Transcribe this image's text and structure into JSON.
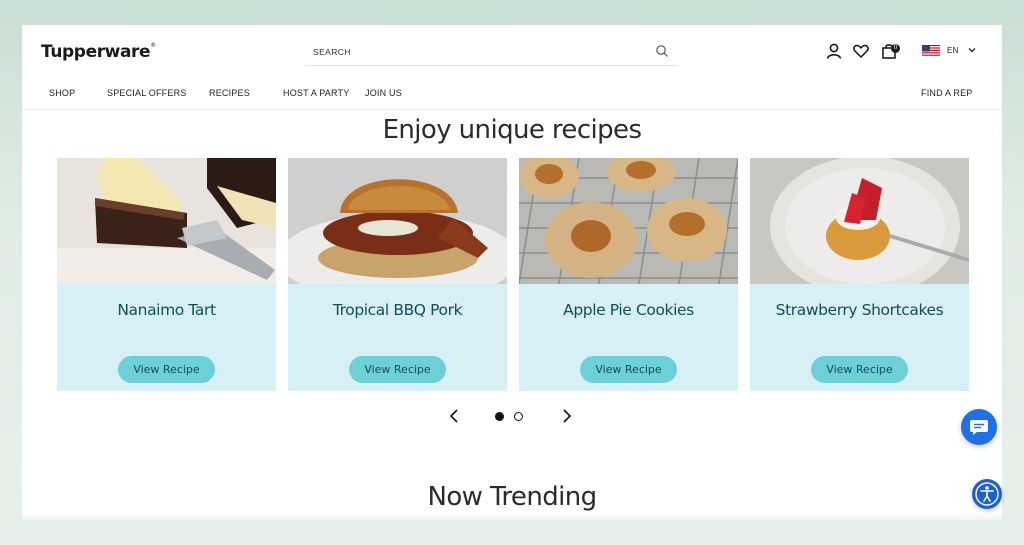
{
  "header": {
    "logo": "Tupperware",
    "logo_mark": "®",
    "search_placeholder": "SEARCH",
    "cart_count": "0",
    "language": "EN"
  },
  "nav": {
    "items": [
      "SHOP",
      "SPECIAL OFFERS",
      "RECIPES",
      "HOST A PARTY",
      "JOIN US"
    ],
    "find_rep": "FIND A REP"
  },
  "recipes_section": {
    "title": "Enjoy unique recipes",
    "cards": [
      {
        "title": "Nanaimo Tart",
        "button": "View Recipe"
      },
      {
        "title": "Tropical BBQ Pork",
        "button": "View Recipe"
      },
      {
        "title": "Apple Pie Cookies",
        "button": "View Recipe"
      },
      {
        "title": "Strawberry Shortcakes",
        "button": "View Recipe"
      }
    ],
    "carousel": {
      "pages": 2,
      "active_page": 1
    }
  },
  "trending_section": {
    "title": "Now Trending"
  },
  "colors": {
    "card_bg": "#d7f0f6",
    "button_bg": "#6cd0d6",
    "title_text": "#12514f",
    "chat_button": "#1f6fe6"
  },
  "icons": [
    "search-icon",
    "account-icon",
    "heart-icon",
    "cart-icon",
    "us-flag-icon",
    "chevron-down-icon",
    "chevron-left-icon",
    "chevron-right-icon",
    "chat-icon",
    "accessibility-icon"
  ]
}
